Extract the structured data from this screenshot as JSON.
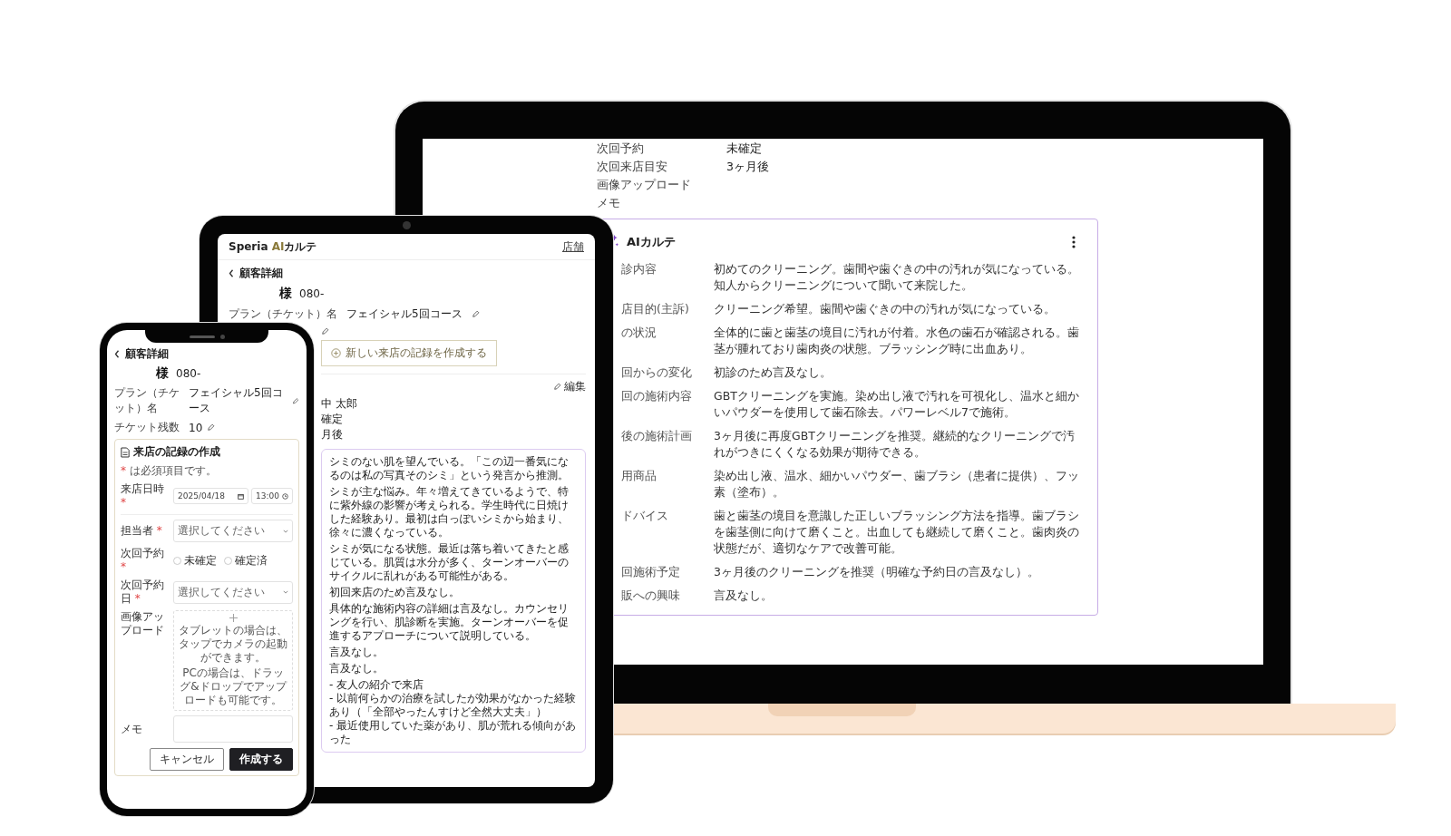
{
  "laptop": {
    "visit_fields": [
      {
        "label": "次回予約",
        "value": "未確定"
      },
      {
        "label": "次回来店目安",
        "value": "3ヶ月後"
      },
      {
        "label": "画像アップロード"
      },
      {
        "label": "メモ"
      }
    ],
    "ai_card": {
      "title": "AIカルテ",
      "rows": [
        {
          "label": "診内容",
          "value": "初めてのクリーニング。歯間や歯ぐきの中の汚れが気になっている。知人からクリーニングについて聞いて来院した。"
        },
        {
          "label": "店目的(主訴)",
          "value": "クリーニング希望。歯間や歯ぐきの中の汚れが気になっている。"
        },
        {
          "label": "の状況",
          "value": "全体的に歯と歯茎の境目に汚れが付着。水色の歯石が確認される。歯茎が腫れており歯肉炎の状態。ブラッシング時に出血あり。"
        },
        {
          "label": "回からの変化",
          "value": "初診のため言及なし。"
        },
        {
          "label": "回の施術内容",
          "value": "GBTクリーニングを実施。染め出し液で汚れを可視化し、温水と細かいパウダーを使用して歯石除去。パワーレベル7で施術。"
        },
        {
          "label": "後の施術計画",
          "value": "3ヶ月後に再度GBTクリーニングを推奨。継続的なクリーニングで汚れがつきにくくなる効果が期待できる。"
        },
        {
          "label": "用商品",
          "value": "染め出し液、温水、細かいパウダー、歯ブラシ（患者に提供）、フッ素（塗布）。"
        },
        {
          "label": "ドバイス",
          "value": "歯と歯茎の境目を意識した正しいブラッシング方法を指導。歯ブラシを歯茎側に向けて磨くこと。出血しても継続して磨くこと。歯肉炎の状態だが、適切なケアで改善可能。"
        },
        {
          "label": "回施術予定",
          "value": "3ヶ月後のクリーニングを推奨（明確な予約日の言及なし）。"
        },
        {
          "label": "販への興味",
          "value": "言及なし。"
        }
      ]
    }
  },
  "tablet": {
    "logo": {
      "before": "Speria",
      "accent": "AI",
      "after": "カルテ"
    },
    "store_link": "店舗",
    "back_label": "顧客詳細",
    "honorific": "様",
    "phone": "080-",
    "plan": {
      "label": "プラン（チケット）名",
      "value": "フェイシャル5回コース"
    },
    "new_visit_button": "新しい来店の記録を作成する",
    "edit_button": "編集",
    "summary_values": [
      "中 太郎",
      "確定",
      "月後"
    ],
    "ai_notes": [
      "シミのない肌を望んでいる。「この辺一番気になるのは私の写真そのシミ」という発言から推測。",
      "シミが主な悩み。年々増えてきているようで、特に紫外線の影響が考えられる。学生時代に日焼けした経験あり。最初は白っぽいシミから始まり、徐々に濃くなっている。",
      "シミが気になる状態。最近は落ち着いてきたと感じている。肌質は水分が多く、ターンオーバーのサイクルに乱れがある可能性がある。",
      "初回来店のため言及なし。",
      "具体的な施術内容の詳細は言及なし。カウンセリングを行い、肌診断を実施。ターンオーバーを促進するアプローチについて説明している。",
      "言及なし。",
      "言及なし。"
    ],
    "ai_note_list": [
      "- 友人の紹介で来店",
      "- 以前何らかの治療を試したが効果がなかった経験あり（「全部やったんすけど全然大丈夫」）",
      "- 最近使用していた薬があり、肌が荒れる傾向があった"
    ]
  },
  "phone": {
    "back_label": "顧客詳細",
    "honorific": "様",
    "phone": "080-",
    "plan": {
      "label": "プラン（チケット）名",
      "value": "フェイシャル5回コース"
    },
    "tickets": {
      "label": "チケット残数",
      "value": "10"
    },
    "form": {
      "title": "来店の記録の作成",
      "required_note": {
        "mark": "*",
        "text": "は必須項目です。"
      },
      "visit_datetime": {
        "label": "来店日時",
        "required_mark": "*",
        "date": "2025/04/18",
        "time": "13:00"
      },
      "staff": {
        "label": "担当者",
        "required_mark": "*",
        "placeholder": "選択してください"
      },
      "next_booking": {
        "label": "次回予約",
        "required_mark": "*",
        "options": [
          {
            "label": "未確定",
            "selected": false
          },
          {
            "label": "確定済",
            "selected": false
          }
        ]
      },
      "next_date": {
        "label": "次回予約日",
        "required_mark": "*",
        "placeholder": "選択してください"
      },
      "upload": {
        "label": "画像アップロード",
        "hints": [
          "タブレットの場合は、タップでカメラの起動ができます。",
          "PCの場合は、ドラッグ&ドロップでアップロードも可能です。"
        ]
      },
      "memo": {
        "label": "メモ"
      },
      "buttons": [
        {
          "label": "キャンセル",
          "kind": "secondary"
        },
        {
          "label": "作成する",
          "kind": "primary"
        }
      ]
    }
  }
}
